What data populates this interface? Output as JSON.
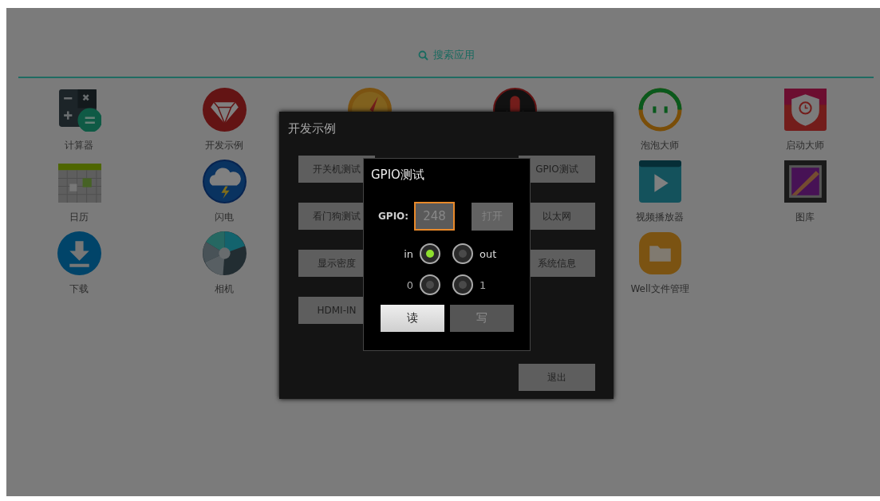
{
  "search": {
    "label": "搜索应用"
  },
  "app_columns": [
    [
      {
        "label": "计算器",
        "kind": "calculator"
      },
      {
        "label": "日历",
        "kind": "calendar"
      },
      {
        "label": "下载",
        "kind": "download"
      }
    ],
    [
      {
        "label": "开发示例",
        "kind": "diamond"
      },
      {
        "label": "闪电",
        "kind": "storm"
      },
      {
        "label": "相机",
        "kind": "aperture"
      }
    ],
    [
      {
        "kind": "compass"
      }
    ],
    [
      {
        "kind": "microphone"
      }
    ],
    [
      {
        "label": "泡泡大师",
        "kind": "face"
      },
      {
        "label": "视频播放器",
        "kind": "video"
      },
      {
        "label": "Well文件管理",
        "kind": "folder"
      }
    ],
    [
      {
        "label": "启动大师",
        "kind": "shield"
      },
      {
        "label": "图库",
        "kind": "gallery"
      }
    ]
  ],
  "dev_dialog": {
    "title": "开发示例",
    "left_buttons": [
      "开关机测试",
      "看门狗测试",
      "显示密度",
      "HDMI-IN"
    ],
    "right_buttons": [
      "GPIO测试",
      "以太网",
      "系统信息"
    ],
    "exit_button": "退出"
  },
  "gpio_dialog": {
    "title": "GPIO测试",
    "field_label": "GPIO:",
    "field_value": "248",
    "field_focused": true,
    "open_button": {
      "label": "打开",
      "disabled": true
    },
    "radio_rows": [
      [
        {
          "label": "in",
          "selected": true
        },
        {
          "label": "out",
          "selected": false
        }
      ],
      [
        {
          "label": "0",
          "selected": false
        },
        {
          "label": "1",
          "selected": false
        }
      ]
    ],
    "buttons": [
      {
        "label": "读",
        "disabled": false
      },
      {
        "label": "写",
        "disabled": true
      }
    ]
  }
}
